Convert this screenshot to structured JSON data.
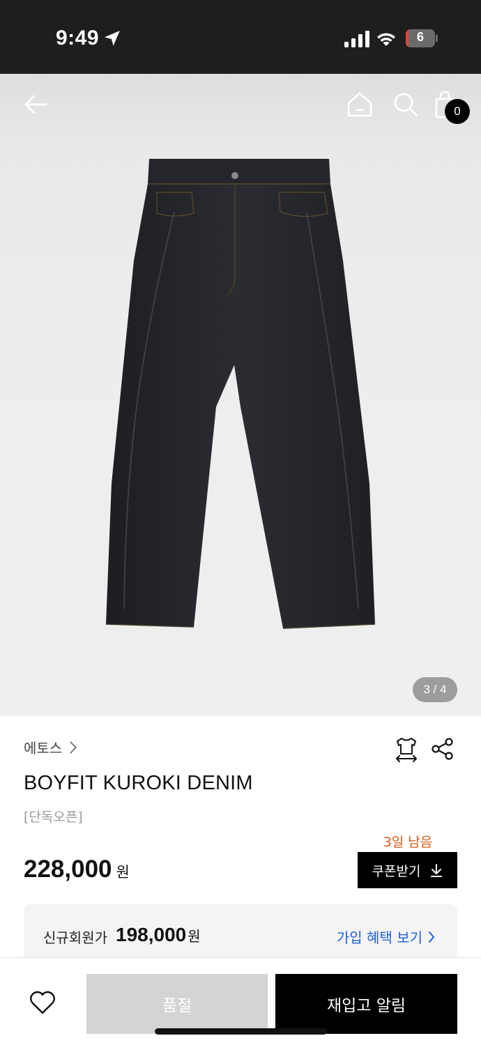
{
  "status_bar": {
    "time": "9:49",
    "battery_level": "6",
    "icons": [
      "location-arrow-icon",
      "cellular-signal-icon",
      "wifi-icon",
      "battery-icon"
    ]
  },
  "nav": {
    "icons": [
      "back-arrow-icon",
      "home-icon",
      "search-icon",
      "shopping-bag-icon"
    ],
    "cart_count": "0"
  },
  "gallery": {
    "page_indicator": "3 / 4",
    "image": "black denim boyfit pants"
  },
  "product": {
    "brand": "에토스",
    "title": "BOYFIT KUROKI DENIM",
    "tag": "[단독오픈]",
    "price": "228,000",
    "price_unit": "원",
    "coupon_days_left": "3일 남음",
    "coupon_button_label": "쿠폰받기"
  },
  "member_offer": {
    "label": "신규회원가",
    "price": "198,000",
    "price_unit": "원",
    "link_label": "가입 혜택 보기"
  },
  "bottom_bar": {
    "soldout_label": "품절",
    "restock_label": "재입고 알림"
  },
  "colors": {
    "accent_orange": "#d65a14",
    "link_blue": "#1f5fe0",
    "status_bar_bg": "#1e1e1e",
    "soldout_bg": "#d4d4d4"
  }
}
